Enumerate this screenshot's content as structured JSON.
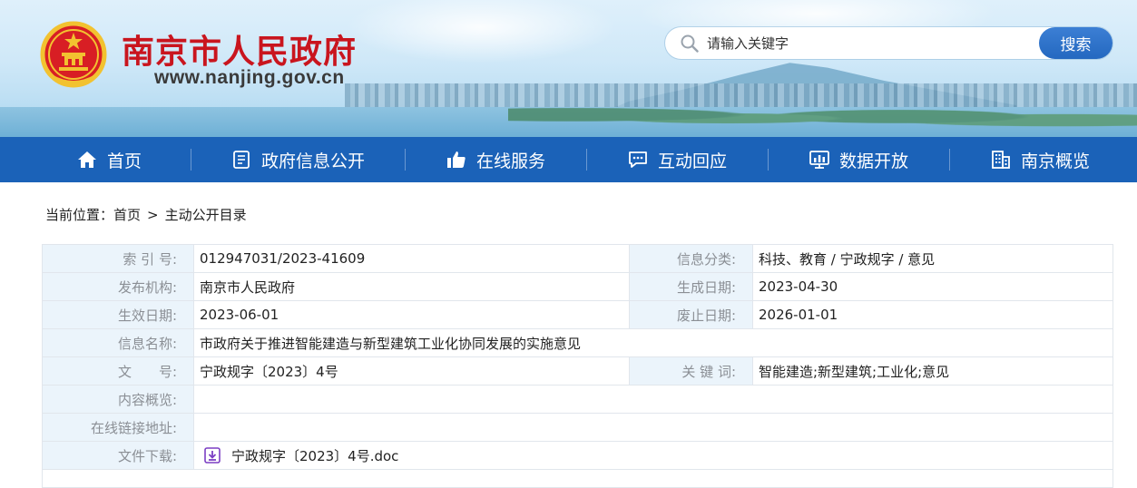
{
  "header": {
    "site_name": "南京市人民政府",
    "site_url": "www.nanjing.gov.cn"
  },
  "search": {
    "placeholder": "请输入关键字",
    "button_label": "搜索"
  },
  "nav": {
    "items": [
      {
        "label": "首页",
        "icon": "home-icon"
      },
      {
        "label": "政府信息公开",
        "icon": "document-icon"
      },
      {
        "label": "在线服务",
        "icon": "thumbs-up-icon"
      },
      {
        "label": "互动回应",
        "icon": "chat-icon"
      },
      {
        "label": "数据开放",
        "icon": "chart-icon"
      },
      {
        "label": "南京概览",
        "icon": "building-icon"
      }
    ]
  },
  "breadcrumb": {
    "prefix": "当前位置：",
    "home": "首页",
    "separator": ">",
    "current": "主动公开目录"
  },
  "info": {
    "index_label": "索 引 号:",
    "index_value": "012947031/2023-41609",
    "category_label": "信息分类:",
    "category_value": "科技、教育 / 宁政规字 / 意见",
    "publisher_label": "发布机构:",
    "publisher_value": "南京市人民政府",
    "created_label": "生成日期:",
    "created_value": "2023-04-30",
    "effective_label": "生效日期:",
    "effective_value": "2023-06-01",
    "expiry_label": "废止日期:",
    "expiry_value": "2026-01-01",
    "title_label": "信息名称:",
    "title_value": "市政府关于推进智能建造与新型建筑工业化协同发展的实施意见",
    "docno_label": "文　　号:",
    "docno_value": "宁政规字〔2023〕4号",
    "keywords_label": "关 键 词:",
    "keywords_value": "智能建造;新型建筑;工业化;意见",
    "summary_label": "内容概览:",
    "summary_value": "",
    "link_label": "在线链接地址:",
    "link_value": "",
    "download_label": "文件下载:",
    "download_value": "宁政规字〔2023〕4号.doc"
  },
  "colors": {
    "brand_red": "#c9151e",
    "nav_blue": "#1b62b8",
    "label_bg": "#ebf4fb",
    "download_icon": "#7b3fc4"
  }
}
